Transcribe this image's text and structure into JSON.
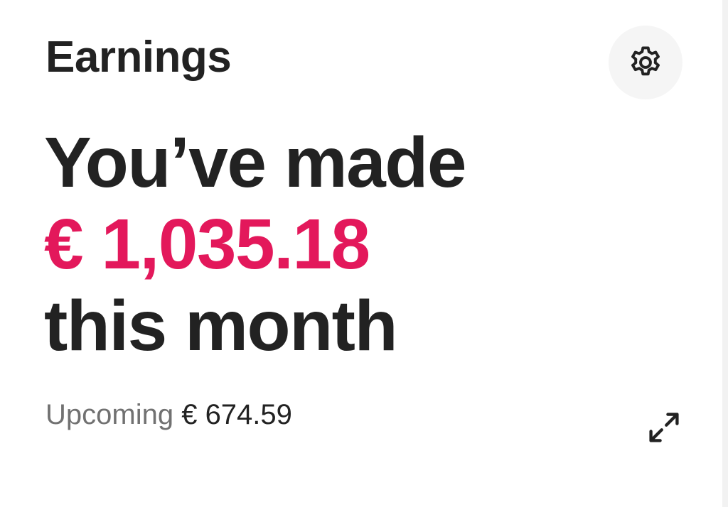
{
  "header": {
    "title": "Earnings",
    "settings_icon": "gear-icon"
  },
  "summary": {
    "line1": "You’ve made",
    "amount": "€ 1,035.18",
    "line3": "this month",
    "amount_color": "#e3185b"
  },
  "upcoming": {
    "label": "Upcoming",
    "value": "€ 674.59"
  },
  "actions": {
    "expand_icon": "expand-icon"
  },
  "colors": {
    "text": "#222222",
    "muted": "#717171",
    "accent": "#e3185b",
    "button_bg": "#f5f5f5"
  }
}
